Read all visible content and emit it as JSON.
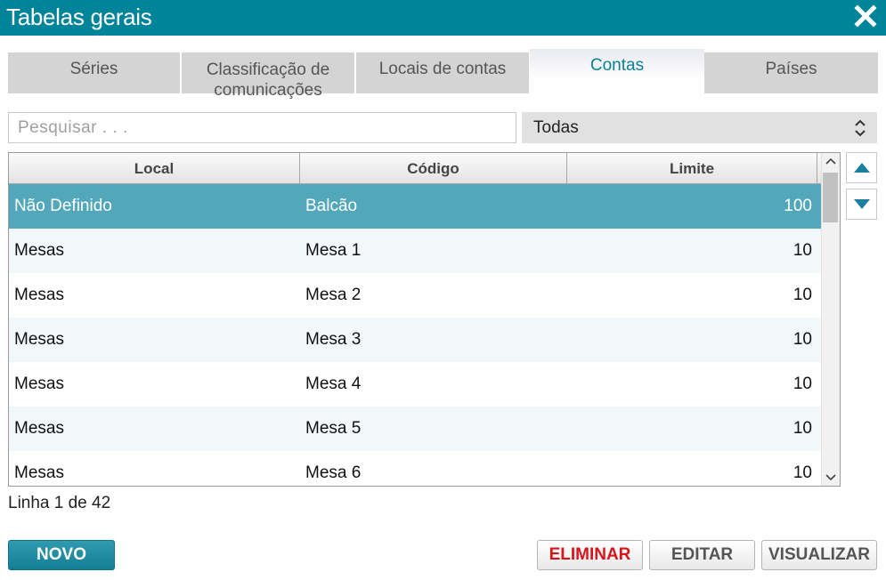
{
  "window": {
    "title": "Tabelas gerais"
  },
  "tabs": [
    {
      "label": "Séries"
    },
    {
      "label": "Classificação de comunicações"
    },
    {
      "label": "Locais de contas"
    },
    {
      "label": "Contas"
    },
    {
      "label": "Países"
    }
  ],
  "filters": {
    "search_placeholder": "Pesquisar . . .",
    "search_value": "",
    "select_value": "Todas"
  },
  "table": {
    "columns": [
      "Local",
      "Código",
      "Limite"
    ],
    "rows": [
      {
        "local": "Não Definido",
        "codigo": "Balcão",
        "limite": "100"
      },
      {
        "local": "Mesas",
        "codigo": "Mesa 1",
        "limite": "10"
      },
      {
        "local": "Mesas",
        "codigo": "Mesa 2",
        "limite": "10"
      },
      {
        "local": "Mesas",
        "codigo": "Mesa 3",
        "limite": "10"
      },
      {
        "local": "Mesas",
        "codigo": "Mesa 4",
        "limite": "10"
      },
      {
        "local": "Mesas",
        "codigo": "Mesa 5",
        "limite": "10"
      },
      {
        "local": "Mesas",
        "codigo": "Mesa 6",
        "limite": "10"
      }
    ]
  },
  "status": {
    "text": "Linha 1 de 42"
  },
  "actions": {
    "new_label": "NOVO",
    "delete_label": "ELIMINAR",
    "edit_label": "EDITAR",
    "view_label": "VISUALIZAR"
  },
  "colors": {
    "accent": "#00849a",
    "selected_row": "#52a8ba",
    "danger": "#d8141b",
    "nav_arrow": "#1b7fa0"
  },
  "icons": {
    "close": "close-icon",
    "select": "chevron-up-down-icon",
    "prev": "triangle-up-icon",
    "next": "triangle-down-icon"
  }
}
